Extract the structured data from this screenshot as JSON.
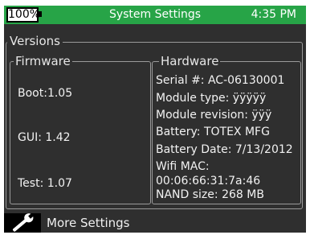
{
  "status": {
    "battery_percent": "100%",
    "title": "System Settings",
    "time": "4:35 PM",
    "accent_color": "#27a447"
  },
  "versions": {
    "legend": "Versions",
    "firmware": {
      "legend": "Firmware",
      "boot": "Boot:1.05",
      "gui": "GUI: 1.42",
      "test": "Test: 1.07"
    },
    "hardware": {
      "legend": "Hardware",
      "serial": "Serial #: AC-06130001",
      "module_type": "Module type: ÿÿÿÿÿ",
      "module_revision": "Module revision: ÿÿÿ",
      "battery": "Battery: TOTEX MFG",
      "battery_date": "Battery Date: 7/13/2012",
      "wifi_mac_label": "Wifi MAC:",
      "wifi_mac": "00:06:66:31:7a:46",
      "nand_size": "NAND size: 268 MB"
    }
  },
  "bottom": {
    "more_settings_label": "More Settings",
    "icon": "wrench-icon"
  }
}
